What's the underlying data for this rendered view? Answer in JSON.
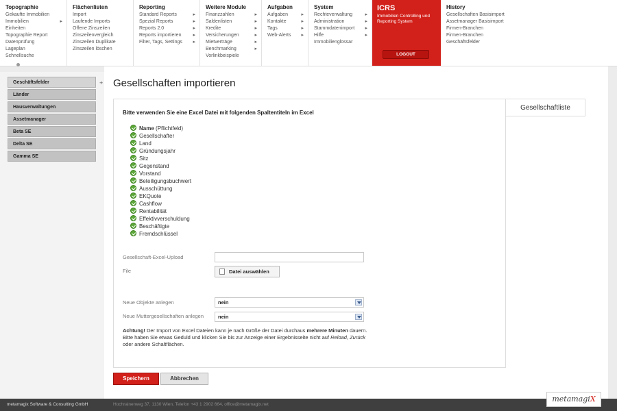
{
  "nav": {
    "columns": [
      {
        "title": "Topographie",
        "items": [
          {
            "label": "Gekaufte Immobilien",
            "arrow": false
          },
          {
            "label": "Immobilien",
            "arrow": true
          },
          {
            "label": "Einheiten",
            "arrow": false
          },
          {
            "label": "Topographie Report",
            "arrow": false
          },
          {
            "label": "Datenprüfung",
            "arrow": false
          },
          {
            "label": "Lageplan",
            "arrow": false
          },
          {
            "label": "Schnellsuche",
            "arrow": false
          }
        ]
      },
      {
        "title": "Flächenlisten",
        "items": [
          {
            "label": "Import",
            "arrow": false
          },
          {
            "label": "Laufende Imports",
            "arrow": false
          },
          {
            "label": "Offene Zinszeilen",
            "arrow": false
          },
          {
            "label": "Zinszeilenvergleich",
            "arrow": false
          },
          {
            "label": "Zinszeilen Duplikate",
            "arrow": false
          },
          {
            "label": "Zinszeilen löschen",
            "arrow": false
          }
        ]
      },
      {
        "title": "Reporting",
        "items": [
          {
            "label": "Standard Reports",
            "arrow": true
          },
          {
            "label": "Spezial Reports",
            "arrow": true
          },
          {
            "label": "Reports 2.0",
            "arrow": true
          },
          {
            "label": "Reports importieren",
            "arrow": true
          },
          {
            "label": "Filter, Tags, Settings",
            "arrow": true
          }
        ]
      },
      {
        "title": "Weitere Module",
        "items": [
          {
            "label": "Finanzzahlen",
            "arrow": true
          },
          {
            "label": "Saldenlisten",
            "arrow": true
          },
          {
            "label": "Kredite",
            "arrow": true
          },
          {
            "label": "Versicherungen",
            "arrow": true
          },
          {
            "label": "Mietverträge",
            "arrow": true
          },
          {
            "label": "Benchmarking",
            "arrow": true
          },
          {
            "label": "Vorlinkbeispiele",
            "arrow": false
          }
        ]
      },
      {
        "title": "Aufgaben",
        "items": [
          {
            "label": "Aufgaben",
            "arrow": true
          },
          {
            "label": "Kontakte",
            "arrow": true
          },
          {
            "label": "Tags",
            "arrow": true
          },
          {
            "label": "Web-Alerts",
            "arrow": true
          }
        ]
      },
      {
        "title": "System",
        "items": [
          {
            "label": "Rechteverwaltung",
            "arrow": true
          },
          {
            "label": "Administration",
            "arrow": true
          },
          {
            "label": "Stammdatenimport",
            "arrow": true
          },
          {
            "label": "Hilfe",
            "arrow": true
          },
          {
            "label": "Immobilienglossar",
            "arrow": false
          }
        ]
      },
      {
        "title": "History",
        "items": [
          {
            "label": "Gesellschaften Basisimport",
            "arrow": false
          },
          {
            "label": "Assetmanager Basisimport",
            "arrow": false
          },
          {
            "label": "Firmen-Branchen",
            "arrow": false
          },
          {
            "label": "Firmen-Branchen",
            "arrow": false
          },
          {
            "label": "Geschäftsfelder",
            "arrow": false
          }
        ]
      }
    ],
    "icrs": {
      "title": "ICRS",
      "subtitle": "Immobilien Controlling und Reporting System",
      "logout": "LOGOUT"
    }
  },
  "sidebar": {
    "items": [
      "Geschäftsfelder",
      "Länder",
      "Hausverwaltungen",
      "Assetmanager",
      "Beta SE",
      "Delta SE",
      "Gamma SE"
    ]
  },
  "page": {
    "title": "Gesellschaften importieren",
    "tab_label": "Gesellschaftliste",
    "intro": "Bitte verwenden Sie eine Excel Datei mit folgenden Spaltentiteln im Excel",
    "fields": [
      {
        "name": "Name",
        "suffix": "(Pflichtfeld)"
      },
      {
        "name": "Gesellschafter",
        "suffix": ""
      },
      {
        "name": "Land",
        "suffix": ""
      },
      {
        "name": "Gründungsjahr",
        "suffix": ""
      },
      {
        "name": "Sitz",
        "suffix": ""
      },
      {
        "name": "Gegenstand",
        "suffix": ""
      },
      {
        "name": "Vorstand",
        "suffix": ""
      },
      {
        "name": "Beteiligungsbuchwert",
        "suffix": ""
      },
      {
        "name": "Ausschüttung",
        "suffix": ""
      },
      {
        "name": "EKQuote",
        "suffix": ""
      },
      {
        "name": "Cashflow",
        "suffix": ""
      },
      {
        "name": "Rentabilität",
        "suffix": ""
      },
      {
        "name": "Effektivverschuldung",
        "suffix": ""
      },
      {
        "name": "Beschäftigte",
        "suffix": ""
      },
      {
        "name": "Fremdschlüssel",
        "suffix": ""
      }
    ],
    "upload_label": "Gesellschaft-Excel-Upload",
    "file_label": "File",
    "file_button": "Datei auswählen",
    "new_objects_label": "Neue Objekte anlegen",
    "new_objects_value": "nein",
    "new_parents_label": "Neue Muttergesellschaften anlegen",
    "new_parents_value": "nein",
    "note_bold": "Achtung!",
    "note_1": " Der Import von Excel Dateien kann je nach Größe der Datei durchaus ",
    "note_1_bold": "mehrere Minuten",
    "note_1_end": " dauern.",
    "note_2": "Bitte haben Sie etwas Geduld und klicken Sie bis zur Anzeige einer Ergebnisseite nicht auf ",
    "note_reload": "Reload",
    "note_sep": ", ",
    "note_back": "Zurück",
    "note_2_end": " oder andere Schaltflächen.",
    "save": "Speichern",
    "cancel": "Abbrechen"
  },
  "footer": {
    "company": "metamagix Software & Consulting GmbH",
    "address": "Hochrainerweg 37, 1130 Wien, Telefon +43 1 2902 664, office@metamagix.net",
    "logo_main": "metamagi",
    "logo_x": "X"
  }
}
